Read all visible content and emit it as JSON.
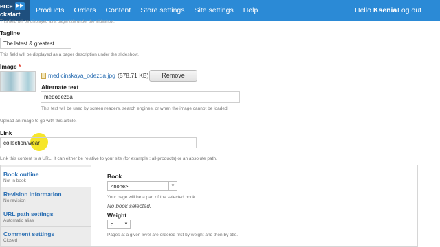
{
  "header": {
    "logo_line1": "erce",
    "logo_line2": "ckstart",
    "nav": [
      "Products",
      "Orders",
      "Content",
      "Store settings",
      "Site settings",
      "Help"
    ],
    "hello_prefix": "Hello ",
    "username": "Ksenia",
    "logout": "Log out"
  },
  "form": {
    "faded_help": "This field will be displayed as a pager title under the slideshow.",
    "tagline_label": "Tagline",
    "tagline_value": "The latest & greatest",
    "tagline_help": "This field will be displayed as a pager description under the slideshow.",
    "image_label": "Image",
    "required_mark": "*",
    "file_name": "medicinskaya_odezda.jpg",
    "file_size": "(578.71 KB)",
    "remove_button": "Remove",
    "alt_label": "Alternate text",
    "alt_value": "medodezda",
    "alt_help": "This text will be used by screen readers, search engines, or when the image cannot be loaded.",
    "upload_help": "Upload an image to go with this article.",
    "link_label": "Link",
    "link_value": "collection/wear",
    "link_help": "Link this content to a URL. It can either be relative to your site (for example : all-products) or an absolute path."
  },
  "vtabs": [
    {
      "title": "Book outline",
      "summary": "Not in book"
    },
    {
      "title": "Revision information",
      "summary": "No revision"
    },
    {
      "title": "URL path settings",
      "summary": "Automatic alias"
    },
    {
      "title": "Comment settings",
      "summary": "Closed"
    }
  ],
  "book_pane": {
    "book_label": "Book",
    "book_select": "<none>",
    "book_help": "Your page will be a part of the selected book.",
    "no_book": "No book selected.",
    "weight_label": "Weight",
    "weight_select": "0",
    "weight_help": "Pages at a given level are ordered first by weight and then by title."
  }
}
